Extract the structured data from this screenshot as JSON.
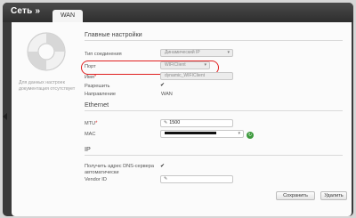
{
  "header": {
    "title": "Сеть »",
    "tab": "WAN"
  },
  "help_text": "Для данных настроек документация отсутствует",
  "sections": {
    "main": "Главные настройки",
    "ethernet": "Ethernet",
    "ip": "IP"
  },
  "fields": {
    "connection_type": {
      "label": "Тип соединения",
      "value": "Динамический IP"
    },
    "port": {
      "label": "Порт",
      "value": "WIFICIient"
    },
    "name": {
      "label": "Имя",
      "value": "dynamic_WIFICIient"
    },
    "allow": {
      "label": "Разрешить",
      "checked": true
    },
    "direction": {
      "label": "Направление",
      "value": "WAN"
    },
    "mtu": {
      "label": "MTU",
      "value": "1500"
    },
    "mac": {
      "label": "MAC"
    },
    "dns": {
      "label": "Получить адрес DNS-сервера автоматически",
      "checked": true
    },
    "vendor": {
      "label": "Vendor ID",
      "value": ""
    }
  },
  "buttons": {
    "save": "Сохранить",
    "delete": "Удалить"
  },
  "colors": {
    "highlight": "#e02020",
    "header": "#3a3a3a"
  }
}
